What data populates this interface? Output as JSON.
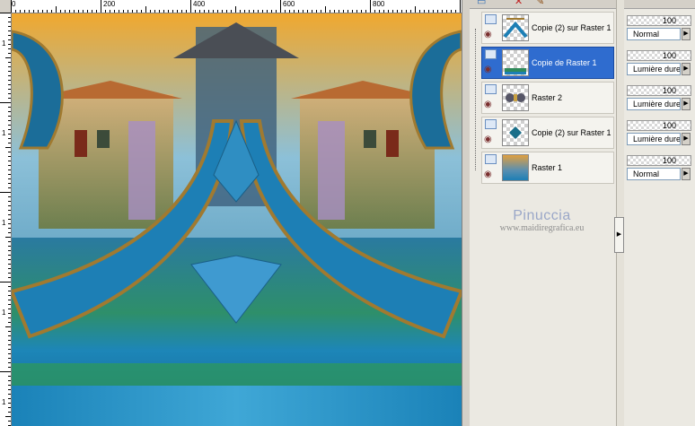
{
  "ruler": {
    "top_labels": [
      "0",
      "200",
      "400",
      "600",
      "800"
    ],
    "left_labels": [
      "1",
      "1",
      "1",
      "1",
      "1"
    ]
  },
  "canvas": {
    "description_colors": {
      "sky": "#e8a23a",
      "teal": "#1b7fb0",
      "green": "#3d8a3a",
      "gold": "#c58b2c"
    }
  },
  "toolbar": {
    "icons": [
      "new-layer-icon",
      "delete-icon",
      "properties-icon"
    ]
  },
  "layers": [
    {
      "name": "Copie (2) sur Raster 1",
      "selected": false,
      "opacity": "100",
      "blend": "Normal"
    },
    {
      "name": "Copie de Raster 1",
      "selected": true,
      "opacity": "100",
      "blend": "Lumière dure"
    },
    {
      "name": "Raster 2",
      "selected": false,
      "opacity": "100",
      "blend": "Lumière dure"
    },
    {
      "name": "Copie (2) sur Raster 1",
      "selected": false,
      "opacity": "100",
      "blend": "Lumière dure"
    },
    {
      "name": "Raster 1",
      "selected": false,
      "opacity": "100",
      "blend": "Normal"
    }
  ],
  "watermark": {
    "title": "Pinuccia",
    "url": "www.maidiregrafica.eu"
  }
}
